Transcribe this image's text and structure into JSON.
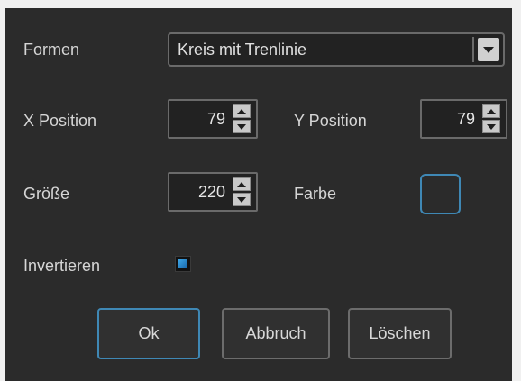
{
  "form": {
    "shapes_label": "Formen",
    "shapes_value": "Kreis mit Trenlinie",
    "x_label": "X Position",
    "x_value": "79",
    "y_label": "Y Position",
    "y_value": "79",
    "size_label": "Größe",
    "size_value": "220",
    "color_label": "Farbe",
    "color_value": "#2b2b2b",
    "invert_label": "Invertieren",
    "invert_checked": true
  },
  "buttons": {
    "ok": "Ok",
    "cancel": "Abbruch",
    "delete": "Löschen"
  },
  "colors": {
    "background": "#2b2b2b",
    "accent": "#3f88b5",
    "border": "#6a6a6a"
  },
  "icons": {
    "dropdown": "chevron-down-icon",
    "spin_up": "arrow-up-icon",
    "spin_down": "arrow-down-icon"
  }
}
